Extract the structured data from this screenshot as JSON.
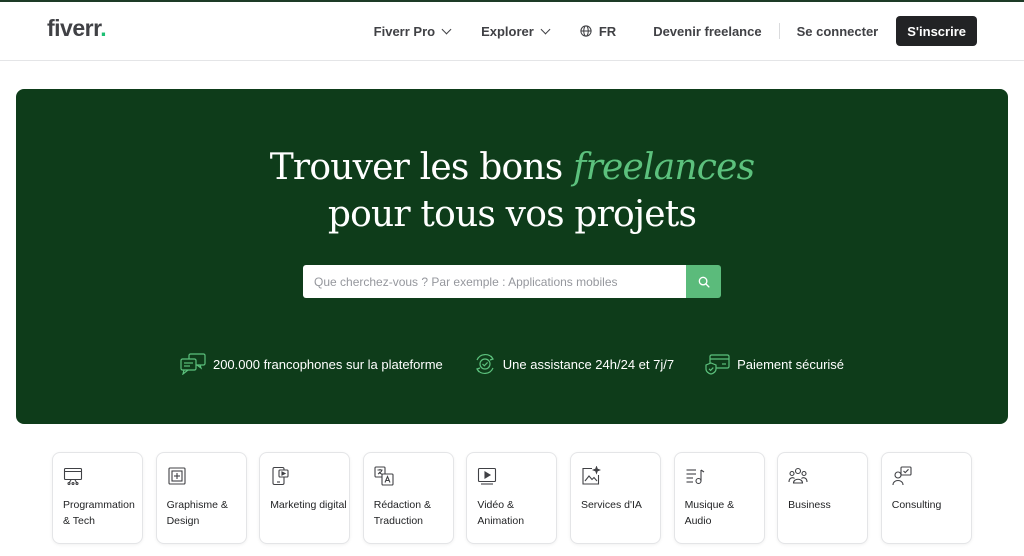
{
  "header": {
    "logo_text": "fiverr",
    "logo_dot": ".",
    "nav": {
      "pro": "Fiverr Pro",
      "explore": "Explorer",
      "lang": "FR",
      "freelance": "Devenir freelance",
      "login": "Se connecter",
      "join": "S'inscrire"
    }
  },
  "hero": {
    "title_part1": "Trouver les bons ",
    "title_accent": "freelances",
    "title_line2": "pour tous vos projets",
    "search_placeholder": "Que cherchez-vous ? Par exemple : Applications mobiles",
    "features": [
      {
        "icon": "chat-bubbles-icon",
        "text": "200.000 francophones sur la plateforme"
      },
      {
        "icon": "support-clock-icon",
        "text": "Une assistance 24h/24 et 7j/7"
      },
      {
        "icon": "secure-card-icon",
        "text": "Paiement sécurisé"
      }
    ]
  },
  "categories": [
    {
      "icon": "programming-icon",
      "label": "Programmation & Tech"
    },
    {
      "icon": "graphic-design-icon",
      "label": "Graphisme & Design"
    },
    {
      "icon": "digital-marketing-icon",
      "label": "Marketing digital"
    },
    {
      "icon": "translation-icon",
      "label": "Rédaction & Traduction"
    },
    {
      "icon": "video-icon",
      "label": "Vidéo & Animation"
    },
    {
      "icon": "ai-services-icon",
      "label": "Services d'IA"
    },
    {
      "icon": "music-icon",
      "label": "Musique & Audio"
    },
    {
      "icon": "business-icon",
      "label": "Business"
    },
    {
      "icon": "consulting-icon",
      "label": "Consulting"
    }
  ],
  "colors": {
    "hero_bg": "#0e3c1a",
    "accent_green": "#5cc17d",
    "search_button": "#5bbb7b",
    "join_button": "#222325"
  }
}
